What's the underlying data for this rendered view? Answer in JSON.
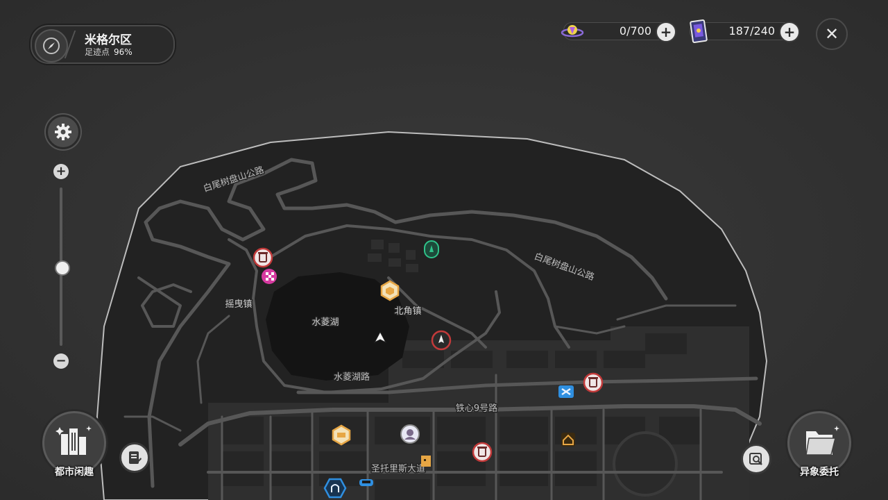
{
  "location": {
    "name": "米格尔区",
    "progress_label": "足迹点",
    "progress_value": "96%"
  },
  "currencies": [
    {
      "icon": "spark-orb-icon",
      "value": "0/700"
    },
    {
      "icon": "card-icon",
      "value": "187/240"
    }
  ],
  "map": {
    "places": {
      "lake": "水菱湖",
      "north_town": "北角镇",
      "sway_town": "摇曳镇",
      "lake_road": "水菱湖路",
      "iron_road": "铁心9号路",
      "ave": "圣托里斯大道",
      "mountain_road_1": "白尾树盘山公路",
      "mountain_road_2": "白尾树盘山公路"
    },
    "accent_red": "#c23a3a",
    "accent_green": "#2fc38a",
    "accent_orange": "#e7a644",
    "accent_blue": "#2f8fe0",
    "accent_pink": "#d63aa0"
  },
  "zoom": {
    "level": 0.5
  },
  "buttons": {
    "city_fun": "都市闲趣",
    "anomaly_commission": "异象委托"
  }
}
